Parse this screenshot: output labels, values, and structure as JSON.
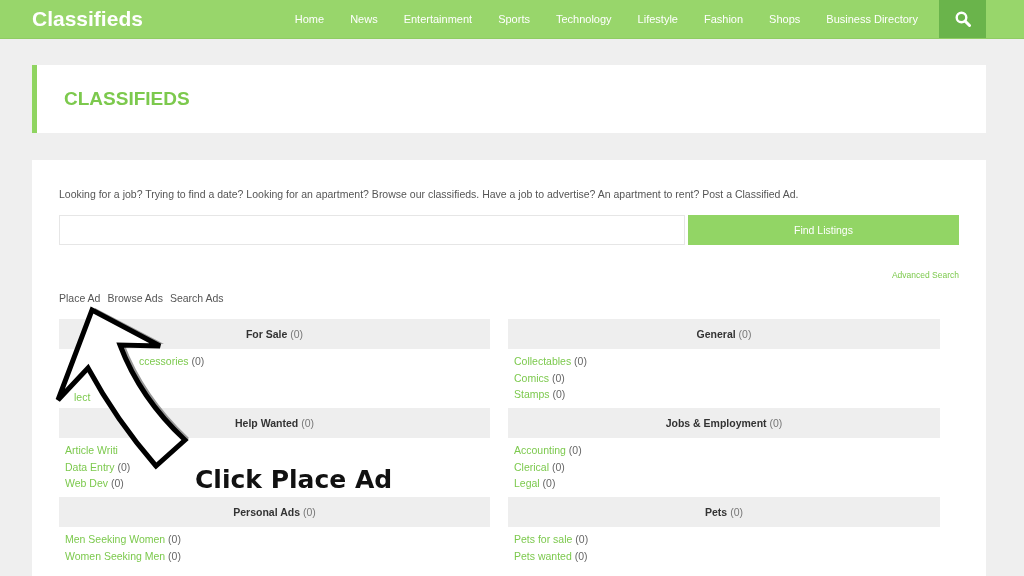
{
  "header": {
    "logo": "Classifieds",
    "nav": [
      "Home",
      "News",
      "Entertainment",
      "Sports",
      "Technology",
      "Lifestyle",
      "Fashion",
      "Shops",
      "Business Directory"
    ]
  },
  "page_title": "CLASSIFIEDS",
  "intro": "Looking for a job? Trying to find a date? Looking for an apartment? Browse our classifieds. Have a job to advertise? An apartment to rent? Post a Classified Ad.",
  "search": {
    "button": "Find Listings",
    "advanced_link": "Advanced Search"
  },
  "actions": [
    "Place Ad",
    "Browse Ads",
    "Search Ads"
  ],
  "categories": [
    {
      "name": "For Sale",
      "count": "(0)",
      "items": [
        {
          "name": "ccessories",
          "count": "(0)"
        },
        {
          "name": "lect"
        }
      ]
    },
    {
      "name": "General",
      "count": "(0)",
      "items": [
        {
          "name": "Collectables",
          "count": "(0)"
        },
        {
          "name": "Comics",
          "count": "(0)"
        },
        {
          "name": "Stamps",
          "count": "(0)"
        }
      ]
    },
    {
      "name": "Help Wanted",
      "count": "(0)",
      "items": [
        {
          "name": "Article Writi"
        },
        {
          "name": "Data Entry",
          "count": "(0)"
        },
        {
          "name": "Web Dev",
          "count": "(0)"
        }
      ]
    },
    {
      "name": "Jobs & Employment",
      "count": "(0)",
      "items": [
        {
          "name": "Accounting",
          "count": "(0)"
        },
        {
          "name": "Clerical",
          "count": "(0)"
        },
        {
          "name": "Legal",
          "count": "(0)"
        }
      ]
    },
    {
      "name": "Personal Ads",
      "count": "(0)",
      "items": [
        {
          "name": "Men Seeking Women",
          "count": "(0)"
        },
        {
          "name": "Women Seeking Men",
          "count": "(0)"
        }
      ]
    },
    {
      "name": "Pets",
      "count": "(0)",
      "items": [
        {
          "name": "Pets for sale",
          "count": "(0)"
        },
        {
          "name": "Pets wanted",
          "count": "(0)"
        }
      ]
    }
  ],
  "annotation": {
    "text": "Click Place Ad"
  }
}
